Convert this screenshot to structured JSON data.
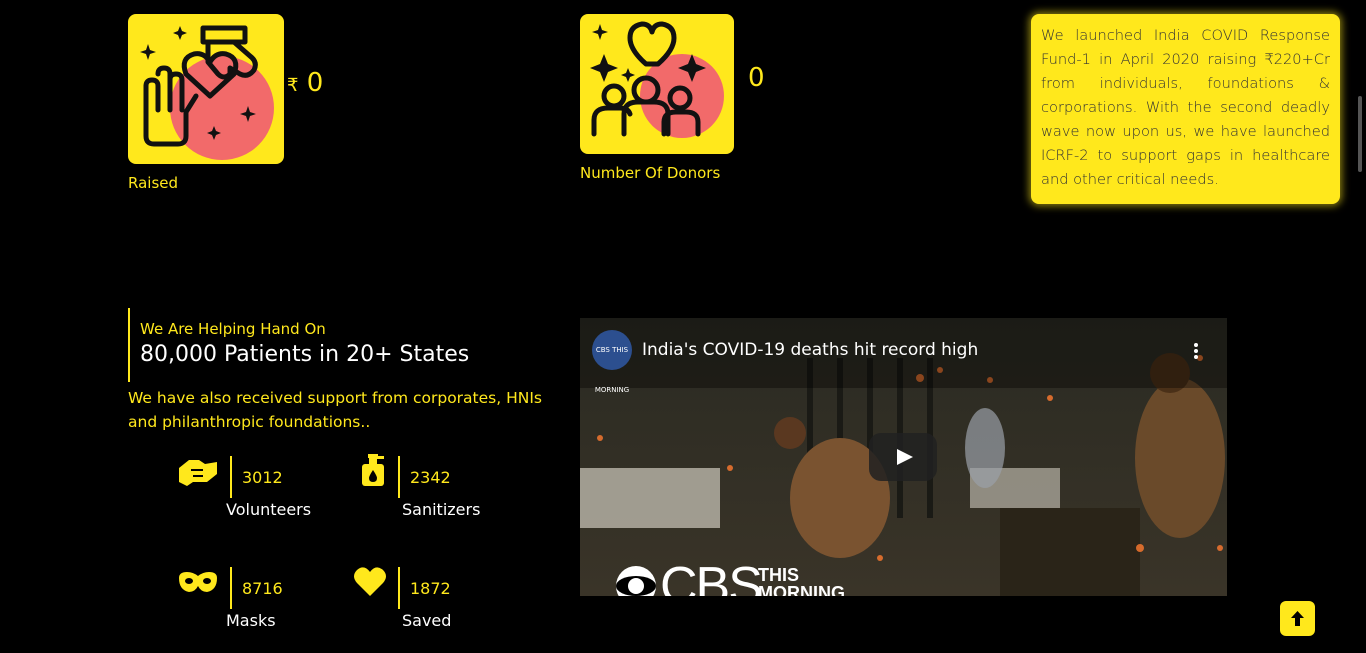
{
  "stats": {
    "raised": {
      "currency": "₹",
      "value": "0",
      "label": "Raised"
    },
    "donors": {
      "value": "0",
      "label": "Number Of Donors"
    }
  },
  "note": {
    "text": "We launched India COVID Response Fund-1 in April 2020 raising ₹220+Cr from individuals, foundations & corporations. With the second deadly wave now upon us, we have launched ICRF-2 to support gaps in healthcare and other critical needs."
  },
  "helping": {
    "subtitle": "We Are Helping Hand On",
    "title": "80,000 Patients in 20+ States",
    "description": "We have also received support from corporates, HNIs and philanthropic foundations.."
  },
  "metrics": [
    {
      "value": "3012",
      "label": "Volunteers",
      "icon": "handshake-icon"
    },
    {
      "value": "2342",
      "label": "Sanitizers",
      "icon": "sanitizer-icon"
    },
    {
      "value": "8716",
      "label": "Masks",
      "icon": "mask-icon"
    },
    {
      "value": "1872",
      "label": "Saved",
      "icon": "heart-icon"
    }
  ],
  "video": {
    "title": "India's COVID-19 deaths hit record high",
    "channel": "CBS THIS MORNING",
    "brand_main": "CBS",
    "brand_line1": "THIS",
    "brand_line2": "MORNING"
  },
  "colors": {
    "accent": "#ffe81c",
    "background": "#000000",
    "blob": "#f26a6a"
  }
}
